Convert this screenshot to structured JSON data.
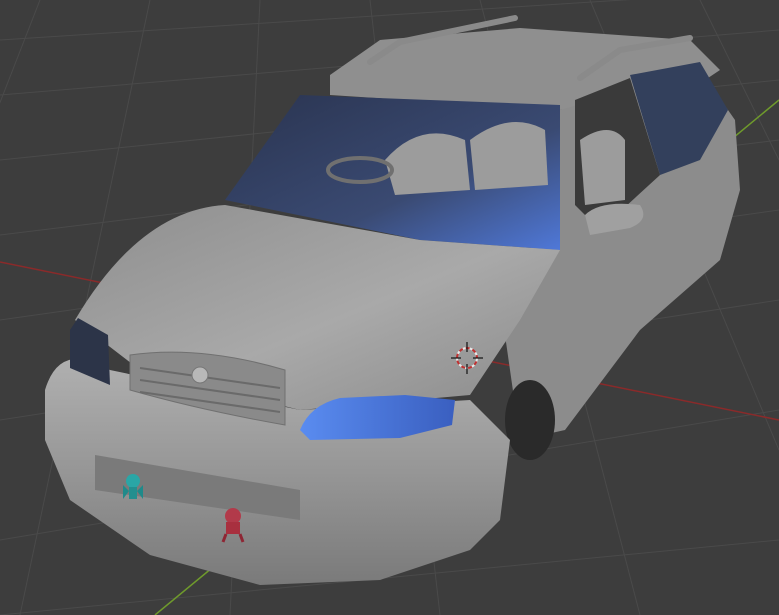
{
  "viewport": {
    "background": "#3d3d3d",
    "grid_color": "#4a4a4a",
    "x_axis_color": "#8a2a2a",
    "y_axis_color": "#6f9a2c"
  },
  "model": {
    "body_color": "#9a9a9a",
    "glass_color": "#2e3a55",
    "headlight_color": "#4a7ae0",
    "selection_highlight": "#4a7ae0"
  },
  "gizmos": {
    "3d_cursor_icon": "3d-cursor-icon",
    "empty_teal_icon": "object-empty-teal-icon",
    "empty_red_icon": "object-empty-red-icon"
  }
}
